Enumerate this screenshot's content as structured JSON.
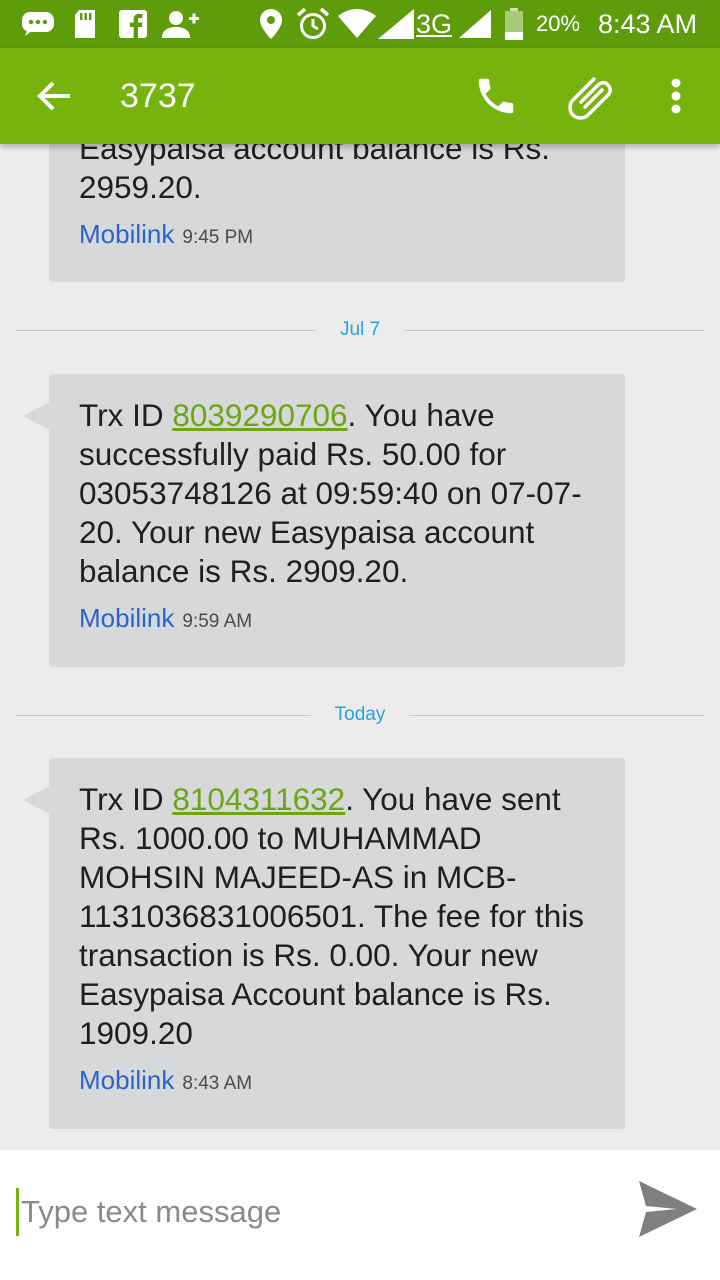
{
  "status_bar": {
    "network": "3G",
    "battery": "20%",
    "time": "8:43 AM"
  },
  "app_bar": {
    "title": "3737",
    "actions": [
      "back-arrow-icon",
      "phone-icon",
      "attachment-icon",
      "more-vert-icon"
    ]
  },
  "messages": [
    {
      "text_before": "Easypaisa account balance is Rs. 2959.20.",
      "sender": "Mobilink",
      "time": "9:45 PM"
    },
    {
      "text_prefix": "Trx ID ",
      "trx_id": "8039290706",
      "text_after": ". You have successfully paid Rs. 50.00 for 03053748126 at 09:59:40 on 07-07-20. Your new Easypaisa account balance is Rs. 2909.20.",
      "sender": "Mobilink",
      "time": "9:59 AM"
    },
    {
      "text_prefix": "Trx ID ",
      "trx_id": "8104311632",
      "text_after": ". You have sent Rs. 1000.00 to MUHAMMAD MOHSIN MAJEED-AS in MCB-1131036831006501. The fee for this transaction is Rs. 0.00. Your new Easypaisa Account balance is Rs. 1909.20",
      "sender": "Mobilink",
      "time": "8:43 AM"
    }
  ],
  "dividers": [
    "Jul 7",
    "Today"
  ],
  "compose": {
    "placeholder": "Type text message"
  },
  "colors": {
    "status_bar": "#5e9c0c",
    "app_bar": "#77b30d",
    "bubble": "#d7d8da",
    "link": "#6ea512",
    "sender": "#2d63c8",
    "divider_label": "#2aa1d8"
  }
}
